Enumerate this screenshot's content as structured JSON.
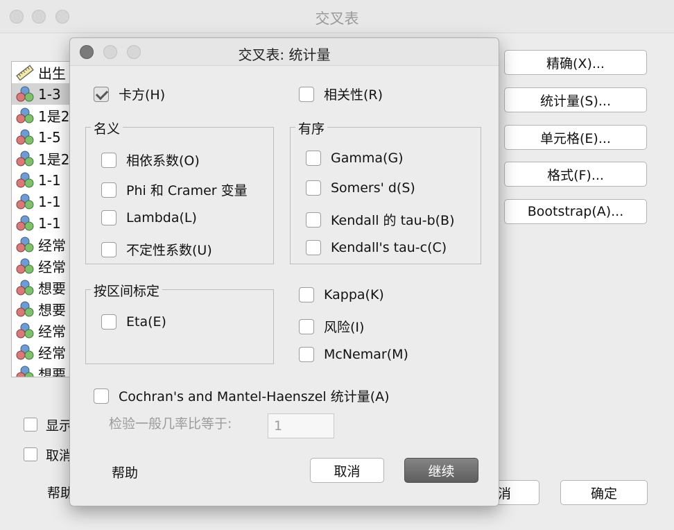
{
  "background_window": {
    "title": "交叉表",
    "variables": [
      "出生",
      "1-3",
      "1是2",
      "1-5",
      "1是2",
      "1-1",
      "1-1",
      "1-1",
      "经常",
      "经常",
      "想要",
      "想要",
      "经常",
      "经常",
      "想要"
    ],
    "selected_index": 1,
    "buttons": [
      "精确(X)...",
      "统计量(S)...",
      "单元格(E)...",
      "格式(F)...",
      "Bootstrap(A)..."
    ],
    "checkboxes": [
      "显示",
      "取消"
    ],
    "help_label": "帮助",
    "cancel_partial": "消",
    "ok_label": "确定"
  },
  "dialog": {
    "title": "交叉表: 统计量",
    "chi_square": {
      "label": "卡方(H)",
      "checked": true
    },
    "correlation": {
      "label": "相关性(R)",
      "checked": false
    },
    "nominal": {
      "title": "名义",
      "items": [
        "相依系数(O)",
        "Phi 和 Cramer 变量",
        "Lambda(L)",
        "不定性系数(U)"
      ]
    },
    "ordinal": {
      "title": "有序",
      "items": [
        "Gamma(G)",
        "Somers' d(S)",
        "Kendall 的 tau-b(B)",
        "Kendall's tau-c(C)"
      ]
    },
    "interval": {
      "title": "按区间标定",
      "items": [
        "Eta(E)"
      ]
    },
    "other": [
      "Kappa(K)",
      "风险(I)",
      "McNemar(M)"
    ],
    "cochran": {
      "label": "Cochran's and Mantel-Haenszel 统计量(A)",
      "checked": false
    },
    "odds_ratio": {
      "label": "检验一般几率比等于:",
      "value": "1"
    },
    "help_label": "帮助",
    "cancel_label": "取消",
    "continue_label": "继续"
  }
}
